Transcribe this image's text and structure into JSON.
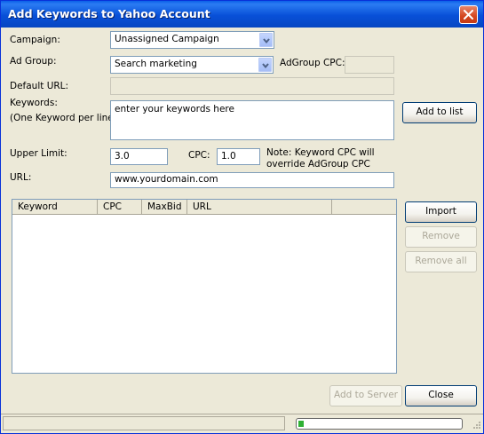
{
  "window": {
    "title": "Add Keywords to Yahoo Account"
  },
  "form": {
    "campaign_label": "Campaign:",
    "campaign_value": "Unassigned Campaign",
    "adgroup_label": "Ad Group:",
    "adgroup_value": "Search marketing",
    "adgroup_cpc_label": "AdGroup CPC:",
    "adgroup_cpc_value": "",
    "default_url_label": "Default URL:",
    "default_url_value": "",
    "keywords_label": "Keywords:",
    "keywords_hint": "(One Keyword per line)",
    "keywords_value": "enter your keywords here",
    "upper_limit_label": "Upper Limit:",
    "upper_limit_value": "3.0",
    "cpc_label": "CPC:",
    "cpc_value": "1.0",
    "note_line1": "Note: Keyword CPC will",
    "note_line2": "override AdGroup CPC",
    "url_label": "URL:",
    "url_value": "www.yourdomain.com"
  },
  "buttons": {
    "add_to_list": "Add to list",
    "import": "Import",
    "remove": "Remove",
    "remove_all": "Remove all",
    "add_to_server": "Add to Server",
    "close": "Close"
  },
  "keyword_table": {
    "columns": [
      "Keyword",
      "CPC",
      "MaxBid",
      "URL"
    ],
    "rows": []
  },
  "status": {
    "progress": 0.02
  },
  "colors": {
    "title_bar": "#0a5fe8",
    "dialog_bg": "#ece9d8",
    "input_border": "#7f9db9",
    "progress_fill": "#2fb135"
  }
}
